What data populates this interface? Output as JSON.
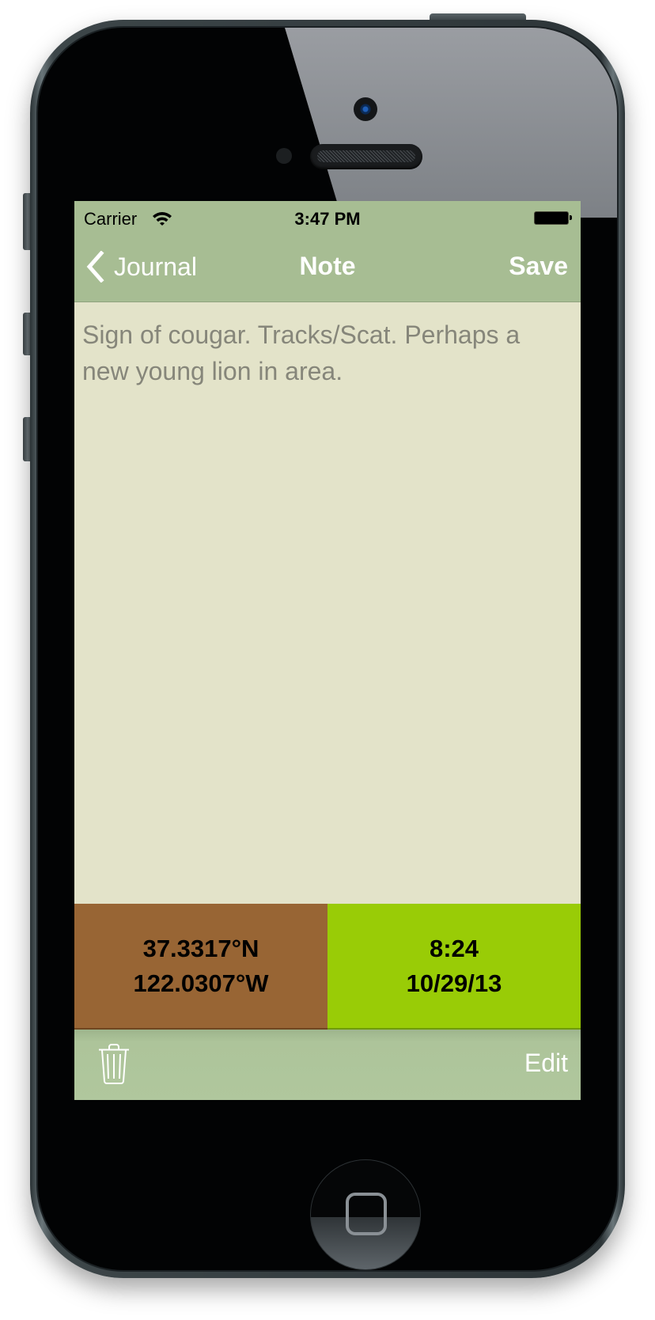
{
  "status_bar": {
    "carrier": "Carrier",
    "wifi_icon": "wifi-icon",
    "time": "3:47 PM",
    "battery_icon": "battery-full-icon"
  },
  "nav": {
    "back_icon": "chevron-left-icon",
    "back_label": "Journal",
    "title": "Note",
    "save_label": "Save"
  },
  "note": {
    "text": "Sign of cougar. Tracks/Scat. Perhaps a new young lion in area."
  },
  "location": {
    "latitude": "37.3317°N",
    "longitude": "122.0307°W"
  },
  "timestamp": {
    "time": "8:24",
    "date": "10/29/13"
  },
  "toolbar": {
    "trash_icon": "trash-icon",
    "edit_label": "Edit"
  },
  "colors": {
    "header_bg": "#a7bd93",
    "note_bg": "#e3e3c9",
    "location_bg": "#986534",
    "timestamp_bg": "#99cc06",
    "toolbar_bg": "#b0c79d",
    "note_text": "#86867a"
  }
}
